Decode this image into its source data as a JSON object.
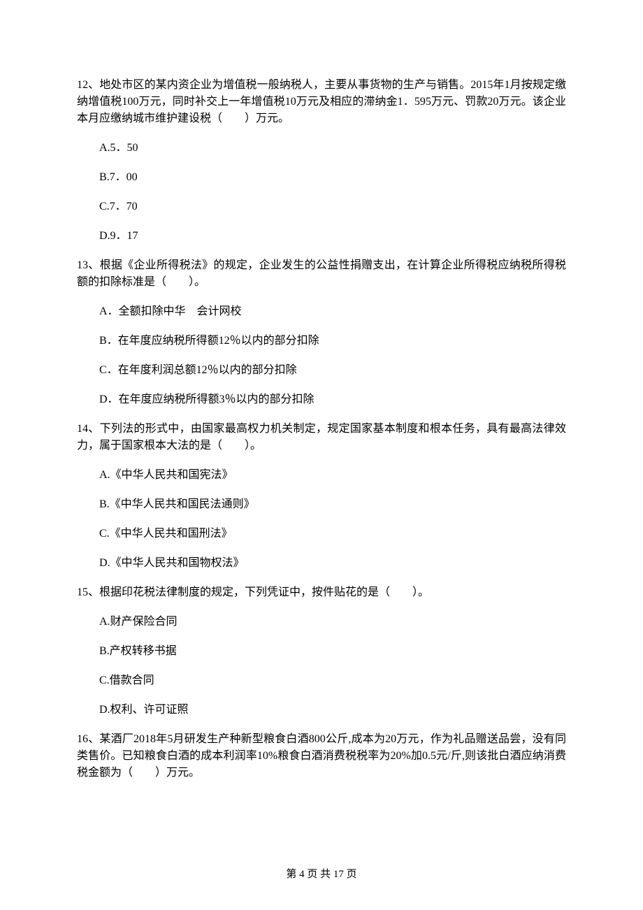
{
  "questions": [
    {
      "number": "12、",
      "stem": "地处市区的某内资企业为增值税一般纳税人，主要从事货物的生产与销售。2015年1月按规定缴纳增值税100万元，同时补交上一年增值税10万元及相应的滞纳金1．595万元、罚款20万元。该企业本月应缴纳城市维护建设税（　　）万元。",
      "options": [
        "A.5．50",
        "B.7．00",
        "C.7．70",
        "D.9．17"
      ]
    },
    {
      "number": "13、",
      "stem": "根据《企业所得税法》的规定，企业发生的公益性捐赠支出，在计算企业所得税应纳税所得税额的扣除标准是（　　）。",
      "options": [
        "A．全额扣除中华　会计网校",
        "B．在年度应纳税所得额12％以内的部分扣除",
        "C．在年度利润总额12％以内的部分扣除",
        "D．在年度应纳税所得额3％以内的部分扣除"
      ]
    },
    {
      "number": "14、",
      "stem": "下列法的形式中，由国家最高权力机关制定，规定国家基本制度和根本任务，具有最高法律效力，属于国家根本大法的是（　　）。",
      "options": [
        "A.《中华人民共和国宪法》",
        "B.《中华人民共和国民法通则》",
        "C.《中华人民共和国刑法》",
        "D.《中华人民共和国物权法》"
      ]
    },
    {
      "number": "15、",
      "stem": "根据印花税法律制度的规定，下列凭证中，按件贴花的是（　　）。",
      "options": [
        "A.财产保险合同",
        "B.产权转移书据",
        "C.借款合同",
        "D.权利、许可证照"
      ]
    },
    {
      "number": "16、",
      "stem": "某酒厂2018年5月研发生产种新型粮食白酒800公斤,成本为20万元，作为礼品赠送品尝，没有同类售价。已知粮食白酒的成本利润率10%粮食白酒消费税税率为20%加0.5元/斤,则该批白酒应纳消费税金额为（　　）万元。",
      "options": []
    }
  ],
  "footer": "第 4 页 共 17 页"
}
